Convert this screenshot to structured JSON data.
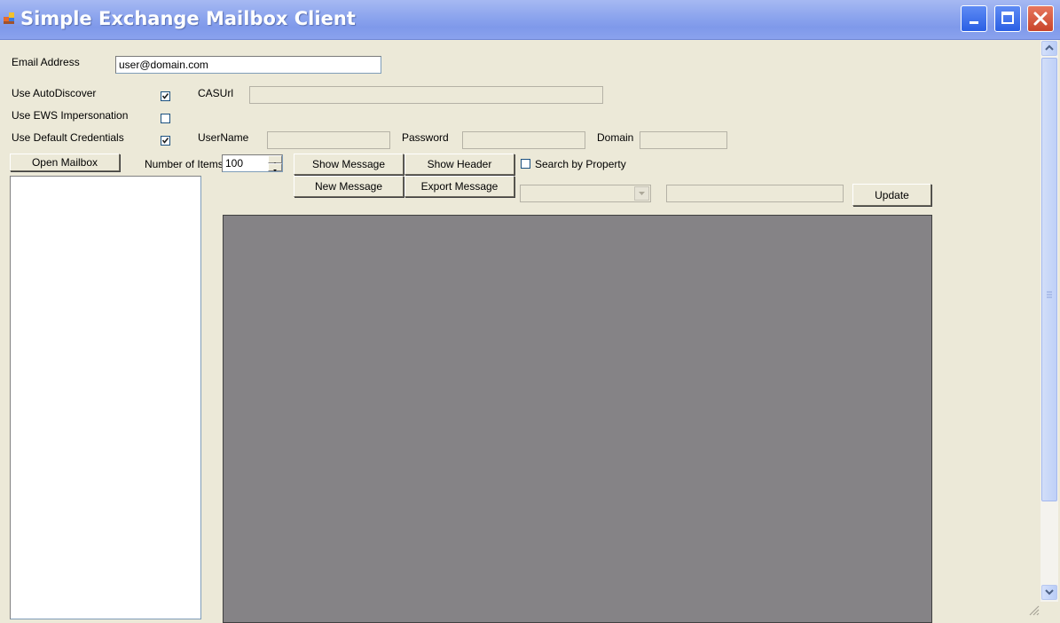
{
  "window": {
    "title": "Simple Exchange Mailbox Client",
    "accent": "#8ea6ee"
  },
  "form": {
    "email_label": "Email Address",
    "email_value": "user@domain.com",
    "autodiscover_label": "Use AutoDiscover",
    "autodiscover_checked": true,
    "impersonation_label": "Use EWS Impersonation",
    "impersonation_checked": false,
    "default_credentials_label": "Use Default Credentials",
    "default_credentials_checked": true,
    "casurl_label": "CASUrl",
    "casurl_value": "",
    "username_label": "UserName",
    "username_value": "",
    "password_label": "Password",
    "password_value": "",
    "domain_label": "Domain",
    "domain_value": ""
  },
  "toolbar": {
    "open_mailbox": "Open Mailbox",
    "number_of_items_label": "Number of Items",
    "number_of_items_value": "100",
    "show_message": "Show Message",
    "show_header": "Show Header",
    "new_message": "New Message",
    "export_message": "Export Message",
    "search_by_property_label": "Search by Property",
    "search_by_property_checked": false,
    "property_select_value": "",
    "property_value": "",
    "update": "Update"
  }
}
